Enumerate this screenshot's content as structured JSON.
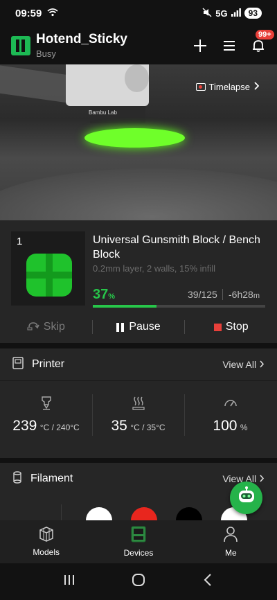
{
  "status_bar": {
    "time": "09:59",
    "network": "5G",
    "battery": "93"
  },
  "header": {
    "device_name": "Hotend_Sticky",
    "device_status": "Busy",
    "notification_count": "99+"
  },
  "camera": {
    "brand_text": "Bambu Lab",
    "timelapse_label": "Timelapse"
  },
  "job": {
    "plate_number": "1",
    "title": "Universal Gunsmith Block / Bench Block",
    "settings": "0.2mm layer, 2 walls, 15% infill",
    "progress_value": "37",
    "progress_unit": "%",
    "progress_fraction": 0.37,
    "layers": "39/125",
    "remaining_value": "-6h28",
    "remaining_unit": "m",
    "actions": {
      "skip": "Skip",
      "pause": "Pause",
      "stop": "Stop"
    }
  },
  "printer": {
    "title": "Printer",
    "view_all": "View All",
    "nozzle": {
      "value": "239",
      "unit": "°C / 240°C"
    },
    "bed": {
      "value": "35",
      "unit": "°C / 35°C"
    },
    "fan": {
      "value": "100",
      "unit": "%"
    }
  },
  "filament": {
    "title": "Filament",
    "view_all": "View All",
    "spools": [
      "#ffffff",
      "#e8261e",
      "#000000",
      "#ffffff"
    ]
  },
  "nav": {
    "models": "Models",
    "devices": "Devices",
    "me": "Me"
  },
  "colors": {
    "accent": "#27c64a",
    "stop": "#e8403a"
  }
}
